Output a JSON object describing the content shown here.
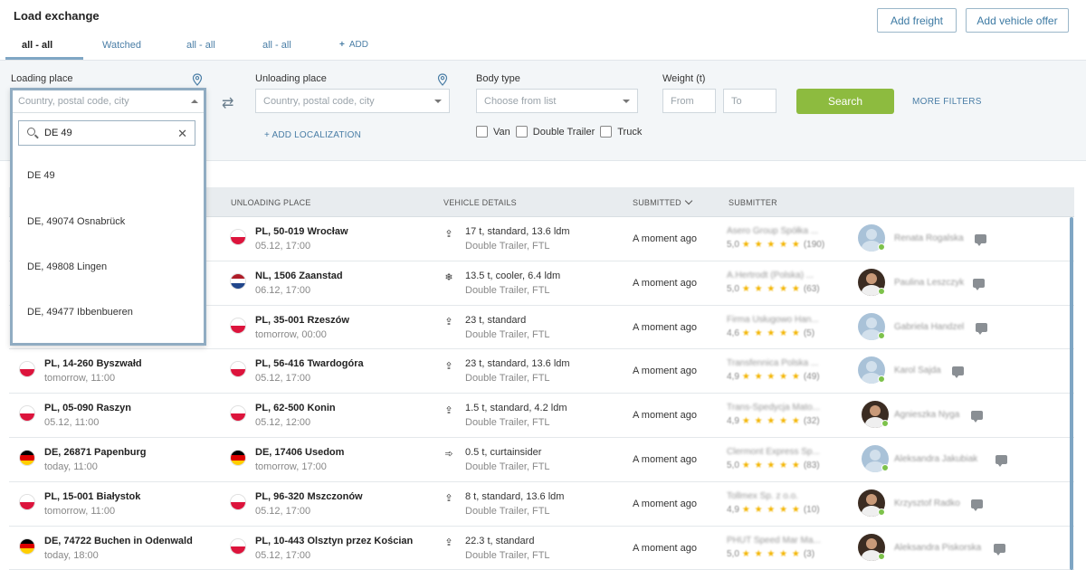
{
  "header": {
    "title": "Load exchange",
    "add_freight": "Add freight",
    "add_vehicle_offer": "Add vehicle offer"
  },
  "tabs": [
    {
      "label": "all - all",
      "active": true
    },
    {
      "label": "Watched"
    },
    {
      "label": "all - all"
    },
    {
      "label": "all - all"
    },
    {
      "label": "ADD",
      "icon": "plus-icon"
    }
  ],
  "filters": {
    "loading_label": "Loading place",
    "loading_placeholder": "Country, postal code, city",
    "unloading_label": "Unloading place",
    "unloading_placeholder": "Country, postal code, city",
    "body_type_label": "Body type",
    "body_type_placeholder": "Choose from list",
    "weight_label": "Weight (t)",
    "weight_from": "From",
    "weight_to": "To",
    "search_label": "Search",
    "more_filters": "MORE FILTERS",
    "add_localization": "+ ADD LOCALIZATION",
    "body_options": [
      "Van",
      "Double Trailer",
      "Truck"
    ]
  },
  "dropdown": {
    "header_placeholder": "Country, postal code, city",
    "search_value": "DE 49",
    "items": [
      "DE 49",
      "DE, 49074 Osnabrück",
      "DE, 49808 Lingen",
      "DE, 49477 Ibbenbueren"
    ]
  },
  "table": {
    "headers": {
      "unloading": "UNLOADING PLACE",
      "vehicle": "VEHICLE DETAILS",
      "submitted": "SUBMITTED",
      "submitter": "SUBMITTER"
    },
    "rows": [
      {
        "load_flag": "pl",
        "load_place": "",
        "load_date": "",
        "unload_flag": "pl",
        "unload_place": "PL, 50-019 Wrocław",
        "unload_date": "05.12, 17:00",
        "vehicle_icon": "box-truck-icon",
        "vehicle_main": "17 t, standard, 13.6 ldm",
        "vehicle_sub": "Double Trailer, FTL",
        "submitted": "A moment ago",
        "company": "Asero Group Spółka ...",
        "rating": "5,0",
        "stars": "★ ★ ★ ★ ★",
        "reviews": "(190)",
        "person": "Renata Rogalska",
        "avatar": "placeholder"
      },
      {
        "load_flag": "pl",
        "load_place": "",
        "load_date": "",
        "unload_flag": "nl",
        "unload_place": "NL, 1506 Zaanstad",
        "unload_date": "06.12, 17:00",
        "vehicle_icon": "snowflake-icon",
        "vehicle_main": "13.5 t, cooler, 6.4 ldm",
        "vehicle_sub": "Double Trailer, FTL",
        "submitted": "A moment ago",
        "company": "A.Hertrodt (Polska) ...",
        "rating": "5,0",
        "stars": "★ ★ ★ ★ ★",
        "reviews": "(63)",
        "person": "Paulina Leszczyk",
        "avatar": "photo"
      },
      {
        "load_flag": "pl",
        "load_place": "",
        "load_date": "",
        "unload_flag": "pl",
        "unload_place": "PL, 35-001 Rzeszów",
        "unload_date": "tomorrow, 00:00",
        "vehicle_icon": "box-truck-icon",
        "vehicle_main": "23 t, standard",
        "vehicle_sub": "Double Trailer, FTL",
        "submitted": "A moment ago",
        "company": "Firma Usługowo Han...",
        "rating": "4,6",
        "stars": "★ ★ ★ ★ ★",
        "reviews": "(5)",
        "person": "Gabriela Handzel",
        "avatar": "placeholder"
      },
      {
        "load_flag": "pl",
        "load_place": "PL, 14-260 Byszwałd",
        "load_date": "tomorrow, 11:00",
        "unload_flag": "pl",
        "unload_place": "PL, 56-416 Twardogóra",
        "unload_date": "05.12, 17:00",
        "vehicle_icon": "box-truck-icon",
        "vehicle_main": "23 t, standard, 13.6 ldm",
        "vehicle_sub": "Double Trailer, FTL",
        "submitted": "A moment ago",
        "company": "Transfennica Polska ...",
        "rating": "4,9",
        "stars": "★ ★ ★ ★ ★",
        "reviews": "(49)",
        "person": "Karol Sajda",
        "avatar": "placeholder"
      },
      {
        "load_flag": "pl",
        "load_place": "PL, 05-090 Raszyn",
        "load_date": "05.12, 11:00",
        "unload_flag": "pl",
        "unload_place": "PL, 62-500 Konin",
        "unload_date": "05.12, 12:00",
        "vehicle_icon": "box-truck-icon",
        "vehicle_main": "1.5 t, standard, 4.2 ldm",
        "vehicle_sub": "Double Trailer, FTL",
        "submitted": "A moment ago",
        "company": "Trans-Spedycja Mato...",
        "rating": "4,9",
        "stars": "★ ★ ★ ★ ★",
        "reviews": "(32)",
        "person": "Agnieszka Nyga",
        "avatar": "photo"
      },
      {
        "load_flag": "de",
        "load_place": "DE, 26871 Papenburg",
        "load_date": "today, 11:00",
        "unload_flag": "de",
        "unload_place": "DE, 17406 Usedom",
        "unload_date": "tomorrow, 17:00",
        "vehicle_icon": "curtainsider-icon",
        "vehicle_main": "0.5 t, curtainsider",
        "vehicle_sub": "Double Trailer, FTL",
        "submitted": "A moment ago",
        "company": "Clermont Express Sp...",
        "rating": "5,0",
        "stars": "★ ★ ★ ★ ★",
        "reviews": "(83)",
        "person": "Aleksandra Jakubiak",
        "avatar": "placeholder"
      },
      {
        "load_flag": "pl",
        "load_place": "PL, 15-001 Białystok",
        "load_date": "tomorrow, 11:00",
        "unload_flag": "pl",
        "unload_place": "PL, 96-320 Mszczonów",
        "unload_date": "05.12, 17:00",
        "vehicle_icon": "box-truck-icon",
        "vehicle_main": "8 t, standard, 13.6 ldm",
        "vehicle_sub": "Double Trailer, FTL",
        "submitted": "A moment ago",
        "company": "Tollmex Sp. z o.o.",
        "rating": "4,9",
        "stars": "★ ★ ★ ★ ★",
        "reviews": "(10)",
        "person": "Krzysztof Radko",
        "avatar": "photo"
      },
      {
        "load_flag": "de",
        "load_place": "DE, 74722 Buchen in Odenwald",
        "load_date": "today, 18:00",
        "unload_flag": "pl",
        "unload_place": "PL, 10-443 Olsztyn przez Kościan",
        "unload_date": "05.12, 17:00",
        "vehicle_icon": "box-truck-icon",
        "vehicle_main": "22.3 t, standard",
        "vehicle_sub": "Double Trailer, FTL",
        "submitted": "A moment ago",
        "company": "PHUT Speed Mar Ma...",
        "rating": "5,0",
        "stars": "★ ★ ★ ★ ★",
        "reviews": "(3)",
        "person": "Aleksandra Piskorska",
        "avatar": "photo"
      }
    ]
  },
  "colors": {
    "accent": "#4a7ea6",
    "search_button": "#8dbb3f",
    "online": "#7dc24b",
    "star": "#f3b400"
  }
}
